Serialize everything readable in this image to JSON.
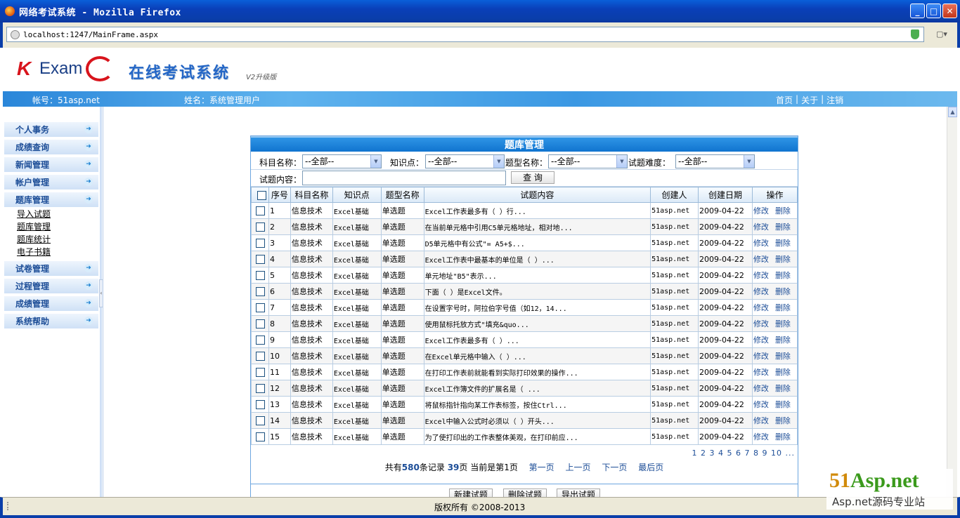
{
  "window": {
    "title": "网络考试系统 - Mozilla Firefox",
    "url": "localhost:1247/MainFrame.aspx"
  },
  "header": {
    "logo_k": "K",
    "logo_exam": "Exam",
    "logo_title": "在线考试系统",
    "logo_version": "V2升级版",
    "account": "帐号：51asp.net",
    "username": "姓名：系统管理用户",
    "links": [
      "首页",
      "关于",
      "注销"
    ]
  },
  "sidebar": {
    "menus": [
      "个人事务",
      "成绩查询",
      "新闻管理",
      "帐户管理",
      "题库管理",
      "试卷管理",
      "过程管理",
      "成绩管理",
      "系统帮助"
    ],
    "submenu": [
      "导入试题",
      "题库管理",
      "题库统计",
      "电子书籍"
    ]
  },
  "panel": {
    "title": "题库管理",
    "filters": {
      "subject_label": "科目名称：",
      "subject_value": "--全部--",
      "knowledge_label": "知识点：",
      "knowledge_value": "--全部--",
      "qtype_label": "题型名称：",
      "qtype_value": "--全部--",
      "difficulty_label": "试题难度：",
      "difficulty_value": "--全部--",
      "content_label": "试题内容：",
      "content_value": "",
      "search_button": "查 询"
    },
    "columns": [
      "序号",
      "科目名称",
      "知识点",
      "题型名称",
      "试题内容",
      "创建人",
      "创建日期",
      "操作"
    ],
    "rows": [
      {
        "no": "1",
        "subject": "信息技术",
        "kp": "Excel基础",
        "type": "单选题",
        "content": "Excel工作表最多有（  ）行...",
        "creator": "51asp.net",
        "date": "2009-04-22"
      },
      {
        "no": "2",
        "subject": "信息技术",
        "kp": "Excel基础",
        "type": "单选题",
        "content": "在当前单元格中引用C5单元格地址，相对地...",
        "creator": "51asp.net",
        "date": "2009-04-22"
      },
      {
        "no": "3",
        "subject": "信息技术",
        "kp": "Excel基础",
        "type": "单选题",
        "content": "D5单元格中有公式\"= A5+$...",
        "creator": "51asp.net",
        "date": "2009-04-22"
      },
      {
        "no": "4",
        "subject": "信息技术",
        "kp": "Excel基础",
        "type": "单选题",
        "content": "Excel工作表中最基本的单位是（      ）...",
        "creator": "51asp.net",
        "date": "2009-04-22"
      },
      {
        "no": "5",
        "subject": "信息技术",
        "kp": "Excel基础",
        "type": "单选题",
        "content": "单元地址\"B5\"表示...",
        "creator": "51asp.net",
        "date": "2009-04-22"
      },
      {
        "no": "6",
        "subject": "信息技术",
        "kp": "Excel基础",
        "type": "单选题",
        "content": "下面（  ）是Excel文件。",
        "creator": "51asp.net",
        "date": "2009-04-22"
      },
      {
        "no": "7",
        "subject": "信息技术",
        "kp": "Excel基础",
        "type": "单选题",
        "content": "在设置字号时，阿拉伯字号值（如12，14...",
        "creator": "51asp.net",
        "date": "2009-04-22"
      },
      {
        "no": "8",
        "subject": "信息技术",
        "kp": "Excel基础",
        "type": "单选题",
        "content": "使用鼠标托放方式\"填充&quo...",
        "creator": "51asp.net",
        "date": "2009-04-22"
      },
      {
        "no": "9",
        "subject": "信息技术",
        "kp": "Excel基础",
        "type": "单选题",
        "content": "Excel工作表最多有（   ）...",
        "creator": "51asp.net",
        "date": "2009-04-22"
      },
      {
        "no": "10",
        "subject": "信息技术",
        "kp": "Excel基础",
        "type": "单选题",
        "content": "在Excel单元格中输入（   ）...",
        "creator": "51asp.net",
        "date": "2009-04-22"
      },
      {
        "no": "11",
        "subject": "信息技术",
        "kp": "Excel基础",
        "type": "单选题",
        "content": "在打印工作表前就能看到实际打印效果的操作...",
        "creator": "51asp.net",
        "date": "2009-04-22"
      },
      {
        "no": "12",
        "subject": "信息技术",
        "kp": "Excel基础",
        "type": "单选题",
        "content": "Excel工作簿文件的扩展名是（  ...",
        "creator": "51asp.net",
        "date": "2009-04-22"
      },
      {
        "no": "13",
        "subject": "信息技术",
        "kp": "Excel基础",
        "type": "单选题",
        "content": "将鼠标指针指向某工作表标签，按住Ctrl...",
        "creator": "51asp.net",
        "date": "2009-04-22"
      },
      {
        "no": "14",
        "subject": "信息技术",
        "kp": "Excel基础",
        "type": "单选题",
        "content": "Excel中输入公式时必须以（      ）开头...",
        "creator": "51asp.net",
        "date": "2009-04-22"
      },
      {
        "no": "15",
        "subject": "信息技术",
        "kp": "Excel基础",
        "type": "单选题",
        "content": "为了使打印出的工作表整体美观，在打印前应...",
        "creator": "51asp.net",
        "date": "2009-04-22"
      }
    ],
    "row_actions": {
      "edit": "修改",
      "delete": "删除"
    },
    "page_numbers": "1 2 3 4 5 6 7 8 9 10 ...",
    "pager": {
      "prefix": "共有",
      "total": "580",
      "records_suffix": "条记录",
      "pages": "39",
      "pages_suffix": "页 当前是第1页",
      "first": "第一页",
      "prev": "上一页",
      "next": "下一页",
      "last": "最后页"
    },
    "buttons": {
      "new": "新建试题",
      "delete": "删除试题",
      "export": "导出试题"
    }
  },
  "footer": {
    "copyright": "版权所有 ©2008-2013"
  },
  "watermark": {
    "brand_a": "51",
    "brand_b": "Asp.net",
    "slogan": "Asp.net源码专业站"
  }
}
